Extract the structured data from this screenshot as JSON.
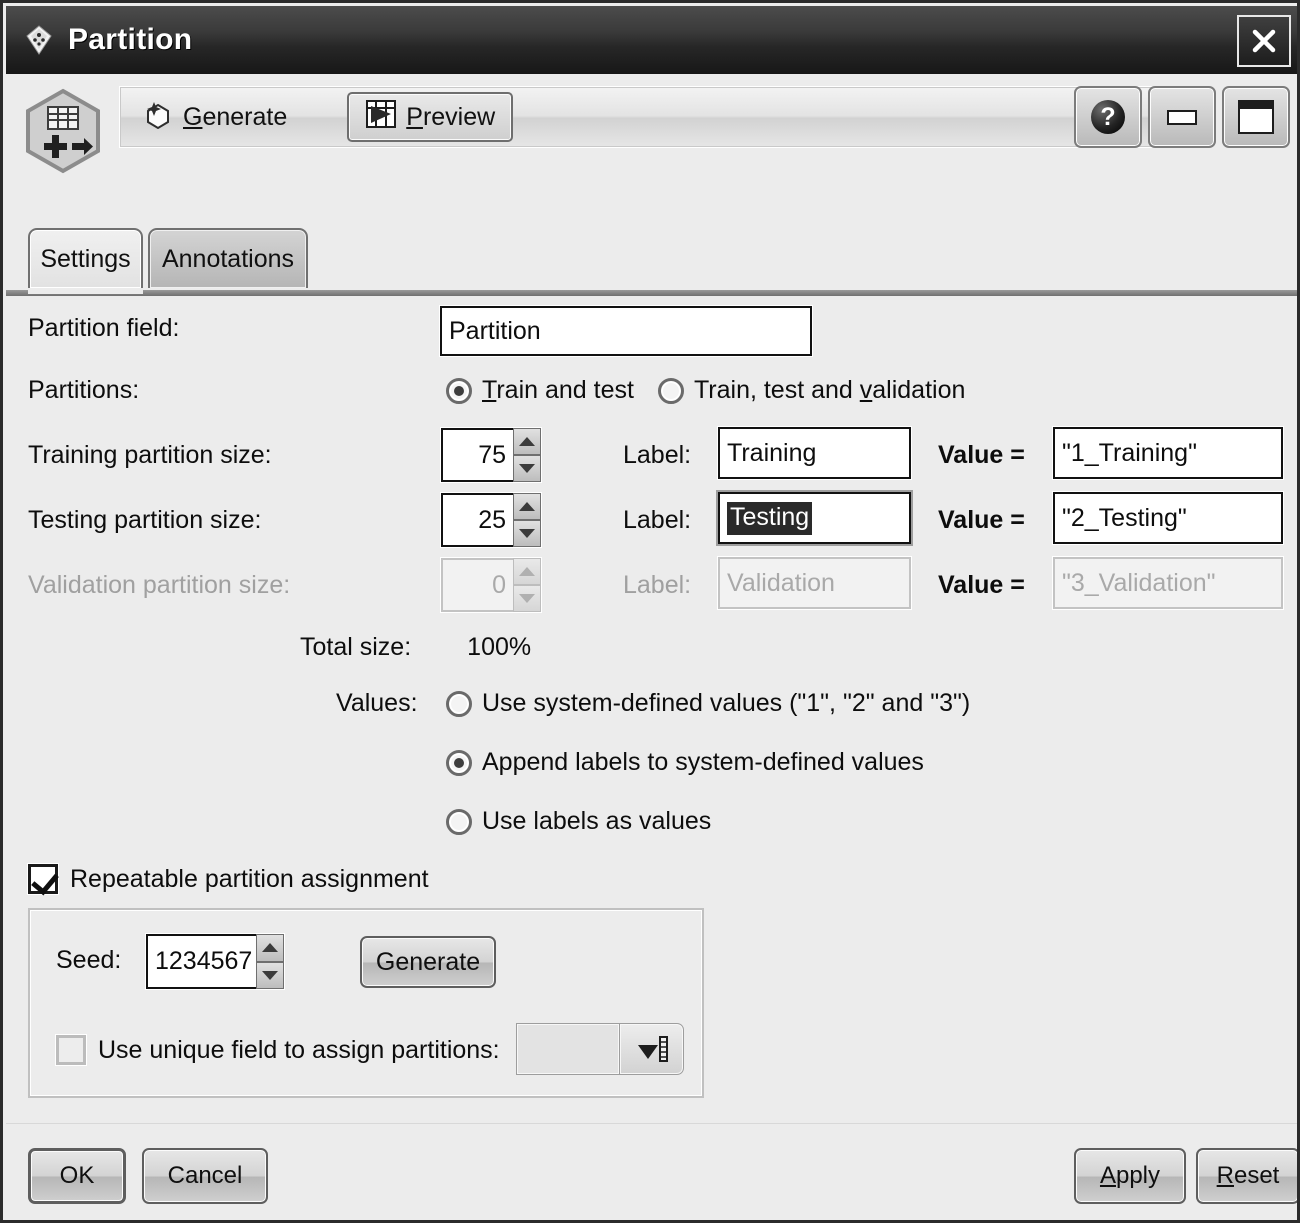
{
  "window": {
    "title": "Partition",
    "title_icon": "gem-icon",
    "close_icon": "close-icon",
    "node_icon": "partition-node-icon"
  },
  "toolbar": {
    "generate": {
      "label": "Generate",
      "mnemonic": "G",
      "icon": "generate-hexagon-icon"
    },
    "preview": {
      "label": "Preview",
      "mnemonic": "P",
      "icon": "preview-table-play-icon"
    },
    "help_icon": "help-question-icon",
    "minimize_icon": "minimize-icon",
    "maximize_icon": "maximize-icon"
  },
  "tabs": [
    {
      "label": "Settings",
      "active": true
    },
    {
      "label": "Annotations",
      "active": false
    }
  ],
  "settings": {
    "partition_field": {
      "label": "Partition field:",
      "value": "Partition"
    },
    "partitions": {
      "label": "Partitions:",
      "options": [
        {
          "label": "Train and test",
          "mnemonic": "T",
          "selected": true
        },
        {
          "label": "Train, test and validation",
          "mnemonic": "v",
          "selected": false
        }
      ]
    },
    "label_caption": "Label:",
    "value_caption": "Value =",
    "rows": [
      {
        "size_label": "Training partition size:",
        "size": "75",
        "label_value": "Training",
        "value": "\"1_Training\"",
        "disabled": false,
        "label_selected": false
      },
      {
        "size_label": "Testing partition size:",
        "size": "25",
        "label_value": "Testing",
        "value": "\"2_Testing\"",
        "disabled": false,
        "label_selected": true
      },
      {
        "size_label": "Validation partition size:",
        "size": "0",
        "label_value": "Validation",
        "value": "\"3_Validation\"",
        "disabled": true,
        "label_selected": false
      }
    ],
    "total": {
      "label": "Total size:",
      "value": "100%"
    },
    "values": {
      "label": "Values:",
      "options": [
        {
          "label": "Use system-defined values (\"1\", \"2\" and \"3\")",
          "selected": false
        },
        {
          "label": "Append labels to system-defined values",
          "selected": true
        },
        {
          "label": "Use labels as values",
          "selected": false
        }
      ]
    },
    "repeatable": {
      "label": "Repeatable partition assignment",
      "checked": true
    },
    "seed": {
      "label": "Seed:",
      "value": "1234567",
      "generate_button": "Generate"
    },
    "unique_field": {
      "label": "Use unique field to assign partitions:",
      "checked": false,
      "value": "",
      "dropdown_icon": "field-chooser-icon"
    }
  },
  "footer": {
    "ok": {
      "label": "OK"
    },
    "cancel": {
      "label": "Cancel"
    },
    "apply": {
      "label": "Apply",
      "mnemonic": "A"
    },
    "reset": {
      "label": "Reset",
      "mnemonic": "R"
    }
  }
}
